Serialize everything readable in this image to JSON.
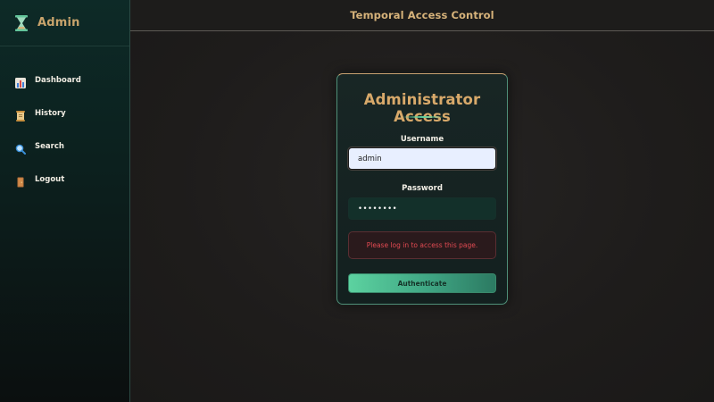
{
  "sidebar": {
    "brand": {
      "title": "Admin",
      "icon": "hourglass-icon"
    },
    "items": [
      {
        "label": "Dashboard",
        "icon": "chart-icon"
      },
      {
        "label": "History",
        "icon": "scroll-icon"
      },
      {
        "label": "Search",
        "icon": "magnifier-icon"
      },
      {
        "label": "Logout",
        "icon": "door-icon"
      }
    ]
  },
  "header": {
    "title": "Temporal Access Control"
  },
  "login": {
    "title": "Administrator Access",
    "username_label": "Username",
    "username_value": "admin",
    "password_label": "Password",
    "password_value": "••••••••",
    "alert_text": "Please log in to access this page.",
    "submit_label": "Authenticate"
  },
  "colors": {
    "accent_gold": "#d8a96a",
    "accent_green": "#5cd2a0",
    "error_red": "#e24a52"
  }
}
